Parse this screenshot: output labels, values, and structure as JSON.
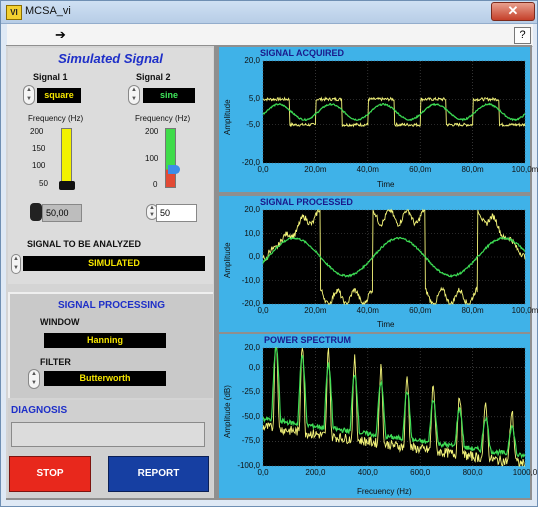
{
  "window": {
    "title": "MCSA_vi",
    "close_label": "✕",
    "help_label": "?",
    "run_icon": "run-arrow-icon"
  },
  "left": {
    "header": "Simulated Signal",
    "signal1": {
      "label": "Signal 1",
      "type": "square",
      "freq_label": "Frequency (Hz)",
      "ticks": [
        "200",
        "150",
        "100",
        "50"
      ],
      "value": "50,00",
      "level_fraction": 0.0
    },
    "signal2": {
      "label": "Signal 2",
      "type": "sine",
      "freq_label": "Frequency (Hz)",
      "ticks": [
        "200",
        "100",
        "0"
      ],
      "value": "50",
      "level_fraction": 0.25
    },
    "analyze_label": "SIGNAL TO BE ANALYZED",
    "analyze_value": "SIMULATED",
    "processing_header": "SIGNAL PROCESSING",
    "window_label": "WINDOW",
    "window_value": "Hanning",
    "filter_label": "FILTER",
    "filter_value": "Butterworth",
    "diagnosis_label": "DIAGNOSIS",
    "diagnosis_value": "",
    "stop_label": "STOP",
    "report_label": "REPORT"
  },
  "colors": {
    "graph_bg": "#3fb2e8",
    "plot_bg": "#000000",
    "trace_yellow": "#f5f57a",
    "trace_green": "#3ddc54",
    "stop": "#e8281c",
    "report": "#163fa2",
    "header_blue": "#1e2fc8"
  },
  "chart_data": [
    {
      "type": "line",
      "title": "SIGNAL ACQUIRED",
      "xlabel": "Time",
      "ylabel": "Amplitude",
      "xlim": [
        0,
        100
      ],
      "ylim": [
        -20,
        20
      ],
      "x_ticks": [
        "0,0",
        "20,0m",
        "40,0m",
        "60,0m",
        "80,0m",
        "100,0m"
      ],
      "y_ticks": [
        "20,0",
        "5,0",
        "-5,0",
        "-20,0"
      ],
      "y_tick_values": [
        20,
        5,
        -5,
        -20
      ],
      "series": [
        {
          "color": "#f5f57a",
          "kind": "square",
          "amplitude": 5,
          "frequency_hz": 50,
          "noise": 0.6
        },
        {
          "color": "#3ddc54",
          "kind": "sine",
          "amplitude": 3,
          "frequency_hz": 50,
          "noise": 0.3
        }
      ]
    },
    {
      "type": "line",
      "title": "SIGNAL PROCESSED",
      "xlabel": "Time",
      "ylabel": "Amplitude",
      "xlim": [
        0,
        100
      ],
      "ylim": [
        -20,
        20
      ],
      "x_ticks": [
        "0,0",
        "20,0m",
        "40,0m",
        "60,0m",
        "80,0m",
        "100,0m"
      ],
      "y_ticks": [
        "20,0",
        "10,0",
        "0,0",
        "-10,0",
        "-20,0"
      ],
      "y_tick_values": [
        20,
        10,
        0,
        -10,
        -20
      ],
      "series": [
        {
          "color": "#f5f57a",
          "kind": "processed",
          "amplitude": 19,
          "frequency_hz": 25,
          "noise": 1.2
        },
        {
          "color": "#3ddc54",
          "kind": "sine",
          "amplitude": 8,
          "frequency_hz": 25,
          "noise": 0.4
        }
      ]
    },
    {
      "type": "line",
      "title": "POWER SPECTRUM",
      "xlabel": "Frecuency (Hz)",
      "ylabel": "Amplitude (dB)",
      "xlim": [
        0,
        1000
      ],
      "ylim": [
        -100,
        20
      ],
      "x_ticks": [
        "0,0",
        "200,0",
        "400,0",
        "600,0",
        "800,0",
        "1000,0"
      ],
      "y_ticks": [
        "20,0",
        "0,0",
        "-25,0",
        "-50,0",
        "-75,0",
        "-100,0"
      ],
      "y_tick_values": [
        20,
        0,
        -25,
        -50,
        -75,
        -100
      ],
      "series": [
        {
          "color": "#f5f57a",
          "kind": "spectrum",
          "peak_db": 6,
          "floor_db": -98
        },
        {
          "color": "#3ddc54",
          "kind": "spectrum-smooth",
          "peak_db": 3,
          "floor_db": -90
        }
      ]
    }
  ]
}
